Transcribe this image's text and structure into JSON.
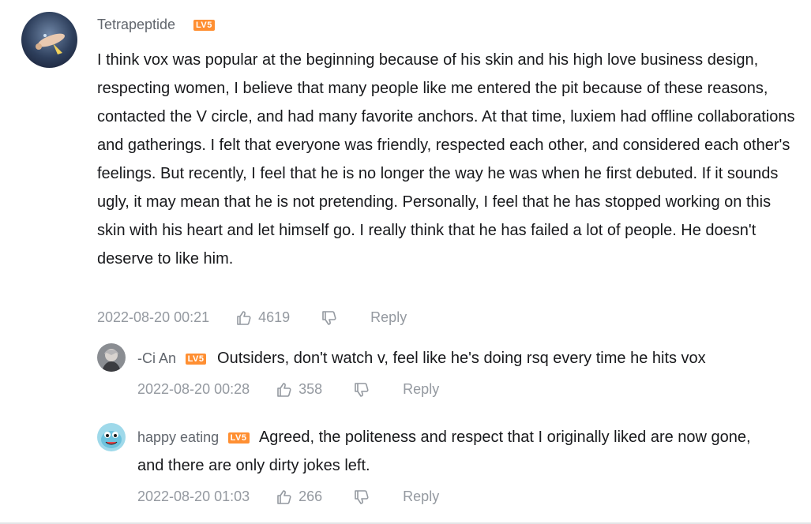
{
  "main_comment": {
    "username": "Tetrapeptide",
    "level": "LV5",
    "text": "I think vox was popular at the beginning because of his skin and his high love business design, respecting women, I believe that many people like me entered the pit because of these reasons, contacted the V circle, and had many favorite anchors. At that time, luxiem had offline collaborations and gatherings. I felt that everyone was friendly, respected each other, and considered each other's feelings. But recently, I feel that he is no longer the way he was when he first debuted. If it sounds ugly, it may mean that he is not pretending. Personally, I feel that he has stopped working on this skin with his heart and let himself go. I really think that he has failed a lot of people. He doesn't deserve to like him.",
    "time": "2022-08-20 00:21",
    "likes": "4619",
    "reply_label": "Reply"
  },
  "replies": [
    {
      "username": "-Ci An",
      "level": "LV5",
      "text": "Outsiders, don't watch v, feel like he's doing rsq every time he hits vox",
      "time": "2022-08-20 00:28",
      "likes": "358",
      "reply_label": "Reply"
    },
    {
      "username": "happy eating",
      "level": "LV5",
      "text": "Agreed, the politeness and respect that I originally liked are now gone, and there are only dirty jokes left.",
      "time": "2022-08-20 01:03",
      "likes": "266",
      "reply_label": "Reply"
    }
  ],
  "colors": {
    "level_badge": "#ff8f32",
    "meta_text": "#9499a0",
    "username_text": "#61666d"
  }
}
